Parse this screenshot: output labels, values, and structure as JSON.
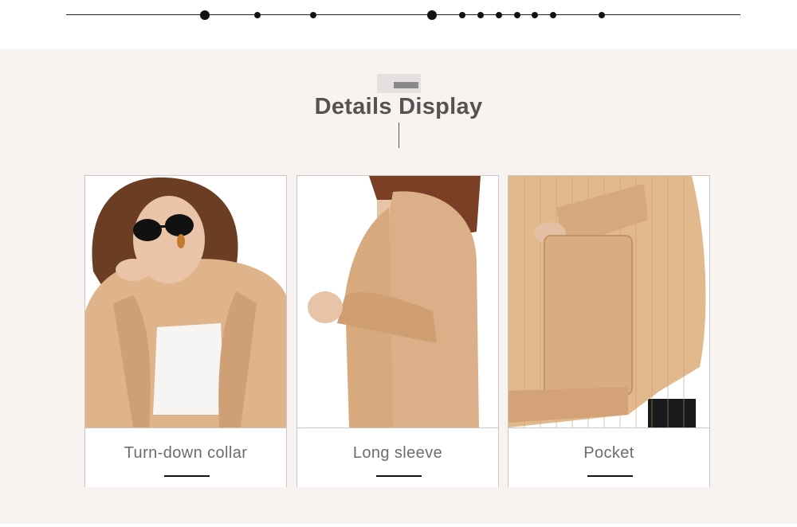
{
  "section": {
    "title": "Details Display"
  },
  "cards": [
    {
      "caption": "Turn-down collar",
      "image": "model-wearing-sunglasses-cardigan-photo"
    },
    {
      "caption": "Long sleeve",
      "image": "cardigan-side-view-photo"
    },
    {
      "caption": "Pocket",
      "image": "cardigan-pocket-closeup-photo"
    }
  ],
  "colors": {
    "section_bg": "#f8f3f1",
    "title": "#555252",
    "caption": "#6f6b6a",
    "knit": "#e0b98f",
    "knit_shadow": "#c99b6d"
  }
}
